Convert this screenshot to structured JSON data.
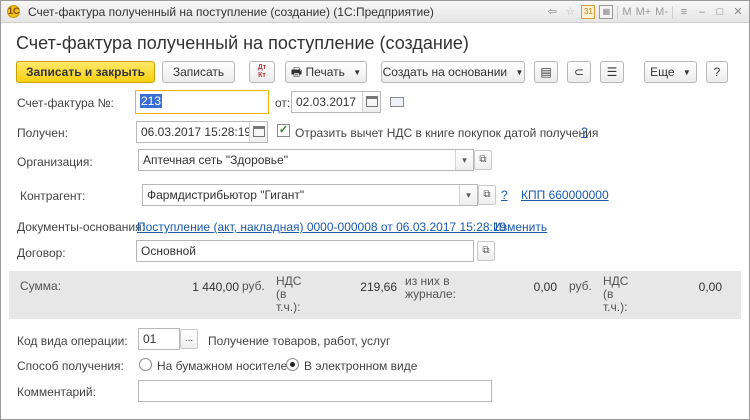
{
  "window": {
    "title": "Счет-фактура полученный на поступление (создание)  (1С:Предприятие)",
    "icons": [
      "back-arrow-icon",
      "favorites-star-icon",
      "calendar-icon",
      "calculator-icon"
    ],
    "mem_buttons": [
      "M",
      "M+",
      "M-"
    ]
  },
  "form": {
    "title": "Счет-фактура полученный на поступление (создание)"
  },
  "toolbar": {
    "save_close": "Записать и закрыть",
    "save": "Записать",
    "dt_kt_top": "Дт",
    "dt_kt_bottom": "Кт",
    "print": "Печать",
    "create_based": "Создать на основании",
    "more": "Еще",
    "help": "?"
  },
  "fields": {
    "invoice_label": "Счет-фактура №:",
    "invoice_number": "213",
    "from_label": "от:",
    "invoice_date": "02.03.2017",
    "received_label": "Получен:",
    "received_datetime": "06.03.2017 15:28:19",
    "vat_deduction_label": "Отразить вычет НДС в книге покупок датой получения",
    "vat_deduction_checked": true,
    "help_q": "?",
    "org_label": "Организация:",
    "org_value": "Аптечная сеть \"Здоровье\"",
    "counterparty_label": "Контрагент:",
    "counterparty_value": "Фармдистрибьютор \"Гигант\"",
    "kpp_link": "КПП 660000000",
    "basis_docs_label": "Документы-основания:",
    "basis_doc_link": "Поступление (акт, накладная) 0000-000008 от 06.03.2017 15:28:19",
    "change_link": "Изменить",
    "contract_label": "Договор:",
    "contract_value": "Основной"
  },
  "summary": {
    "sum_label": "Сумма:",
    "sum_value": "1 440,00",
    "currency1": "руб.",
    "vat_label_1": "НДС",
    "vat_label_2": "(в",
    "vat_label_3": "т.ч.):",
    "vat_value": "219,66",
    "journal_label_1": "из них в",
    "journal_label_2": "журнале:",
    "journal_value": "0,00",
    "currency2": "руб.",
    "vat2_label_1": "НДС",
    "vat2_label_2": "(в",
    "vat2_label_3": "т.ч.):",
    "vat2_value": "0,00"
  },
  "bottom": {
    "op_code_label": "Код вида операции:",
    "op_code_value": "01",
    "op_code_btn": "...",
    "op_code_desc": "Получение товаров, работ, услуг",
    "method_label": "Способ получения:",
    "method_paper": "На бумажном носителе",
    "method_electronic": "В электронном виде",
    "method_selected": "electronic",
    "comment_label": "Комментарий:",
    "comment_value": ""
  }
}
